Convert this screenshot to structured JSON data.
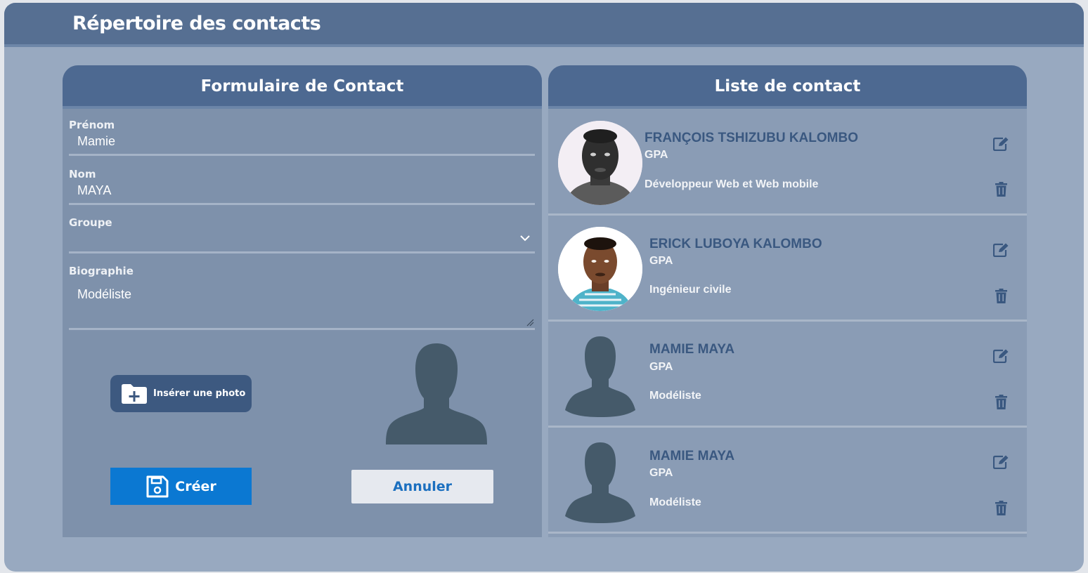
{
  "header": {
    "title": "Répertoire des contacts"
  },
  "form": {
    "title": "Formulaire de Contact",
    "fields": {
      "prenom": {
        "label": "Prénom",
        "value": "Mamie"
      },
      "nom": {
        "label": "Nom",
        "value": "MAYA"
      },
      "groupe": {
        "label": "Groupe",
        "value": ""
      },
      "biographie": {
        "label": "Biographie",
        "value": "Modéliste"
      }
    },
    "insert_photo_label": "Insérer une photo",
    "create_label": "Créer",
    "cancel_label": "Annuler"
  },
  "list": {
    "title": "Liste de contact",
    "contacts": [
      {
        "name": "FRANÇOIS TSHIZUBU KALOMBO",
        "group": "GPA",
        "bio": "Développeur Web et Web mobile",
        "photo": "portrait-photo-bw"
      },
      {
        "name": "ERICK LUBOYA KALOMBO",
        "group": "GPA",
        "bio": "Ingénieur civile",
        "photo": "portrait-photo-color"
      },
      {
        "name": "MAMIE MAYA",
        "group": "GPA",
        "bio": "Modéliste",
        "photo": "default-avatar"
      },
      {
        "name": "MAMIE MAYA",
        "group": "GPA",
        "bio": "Modéliste",
        "photo": "default-avatar"
      }
    ]
  },
  "colors": {
    "header_bg": "#566f92",
    "panel_header_bg": "#4d6991",
    "primary_button": "#0b78d2",
    "contact_name": "#3a5880",
    "avatar_silhouette": "#455a6a"
  },
  "icons": [
    "chevron-down-icon",
    "folder-plus-icon",
    "floppy-disk-icon",
    "edit-icon",
    "trash-icon",
    "user-silhouette-icon"
  ]
}
